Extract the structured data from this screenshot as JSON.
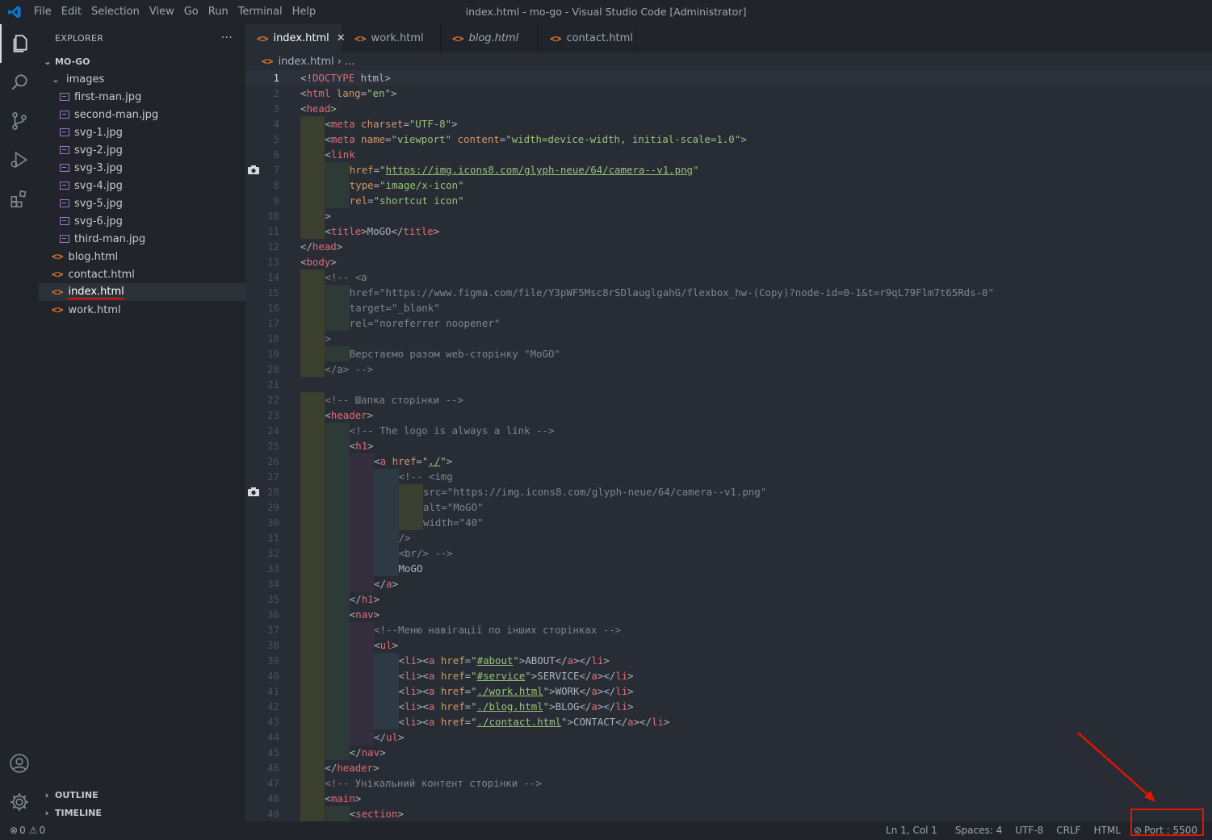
{
  "titlebar": {
    "menu": [
      "File",
      "Edit",
      "Selection",
      "View",
      "Go",
      "Run",
      "Terminal",
      "Help"
    ],
    "window_title": "index.html - mo-go - Visual Studio Code [Administrator]"
  },
  "sidebar": {
    "title": "EXPLORER",
    "more": "···",
    "root": "MO-GO",
    "folder": "images",
    "images": [
      "first-man.jpg",
      "second-man.jpg",
      "svg-1.jpg",
      "svg-2.jpg",
      "svg-3.jpg",
      "svg-4.jpg",
      "svg-5.jpg",
      "svg-6.jpg",
      "third-man.jpg"
    ],
    "files": [
      "blog.html",
      "contact.html",
      "index.html",
      "work.html"
    ],
    "outline": "OUTLINE",
    "timeline": "TIMELINE"
  },
  "tabs": [
    {
      "label": "index.html",
      "active": true
    },
    {
      "label": "work.html"
    },
    {
      "label": "blog.html",
      "italic": true
    },
    {
      "label": "contact.html"
    }
  ],
  "breadcrumb": {
    "file": "index.html",
    "sep": "›",
    "rest": "..."
  },
  "code_lines": [
    "<!DOCTYPE html>",
    "<html lang=\"en\">",
    "<head>",
    "    <meta charset=\"UTF-8\">",
    "    <meta name=\"viewport\" content=\"width=device-width, initial-scale=1.0\">",
    "    <link",
    "        href=\"https://img.icons8.com/glyph-neue/64/camera--v1.png\"",
    "        type=\"image/x-icon\"",
    "        rel=\"shortcut icon\"",
    "    >",
    "    <title>MoGO</title>",
    "</head>",
    "<body>",
    "    <!-- <a",
    "        href=\"https://www.figma.com/file/Y3pWF5Msc8rSDlauglgahG/flexbox_hw-(Copy)?node-id=0-1&t=r9qL79Flm7t65Rds-0\"",
    "        target=\"_blank\"",
    "        rel=\"noreferrer noopener\"",
    "    >",
    "        Верстаємо разом web-сторінку \"MoGO\"",
    "    </a> -->",
    "",
    "    <!-- Шапка сторінки -->",
    "    <header>",
    "        <!-- The logo is always a link -->",
    "        <h1>",
    "            <a href=\"./\">",
    "                <!-- <img",
    "                    src=\"https://img.icons8.com/glyph-neue/64/camera--v1.png\"",
    "                    alt=\"MoGO\"",
    "                    width=\"40\"",
    "                />",
    "                <br/> -->",
    "                MoGO",
    "            </a>",
    "        </h1>",
    "        <nav>",
    "            <!--Меню навігації по інших сторінках -->",
    "            <ul>",
    "                <li><a href=\"#about\">ABOUT</a></li>",
    "                <li><a href=\"#service\">SERVICE</a></li>",
    "                <li><a href=\"./work.html\">WORK</a></li>",
    "                <li><a href=\"./blog.html\">BLOG</a></li>",
    "                <li><a href=\"./contact.html\">CONTACT</a></li>",
    "            </ul>",
    "        </nav>",
    "    </header>",
    "    <!-- Унікальний контент сторінки -->",
    "    <main>",
    "        <section>"
  ],
  "statusbar": {
    "errors": "0",
    "warnings": "0",
    "position": "Ln 1, Col 1",
    "spaces": "Spaces: 4",
    "encoding": "UTF-8",
    "eol": "CRLF",
    "language": "HTML",
    "port": "Port : 5500"
  },
  "colors": {
    "accent_red": "#e51400",
    "html_icon": "#e37933",
    "image_icon": "#a074c4"
  }
}
